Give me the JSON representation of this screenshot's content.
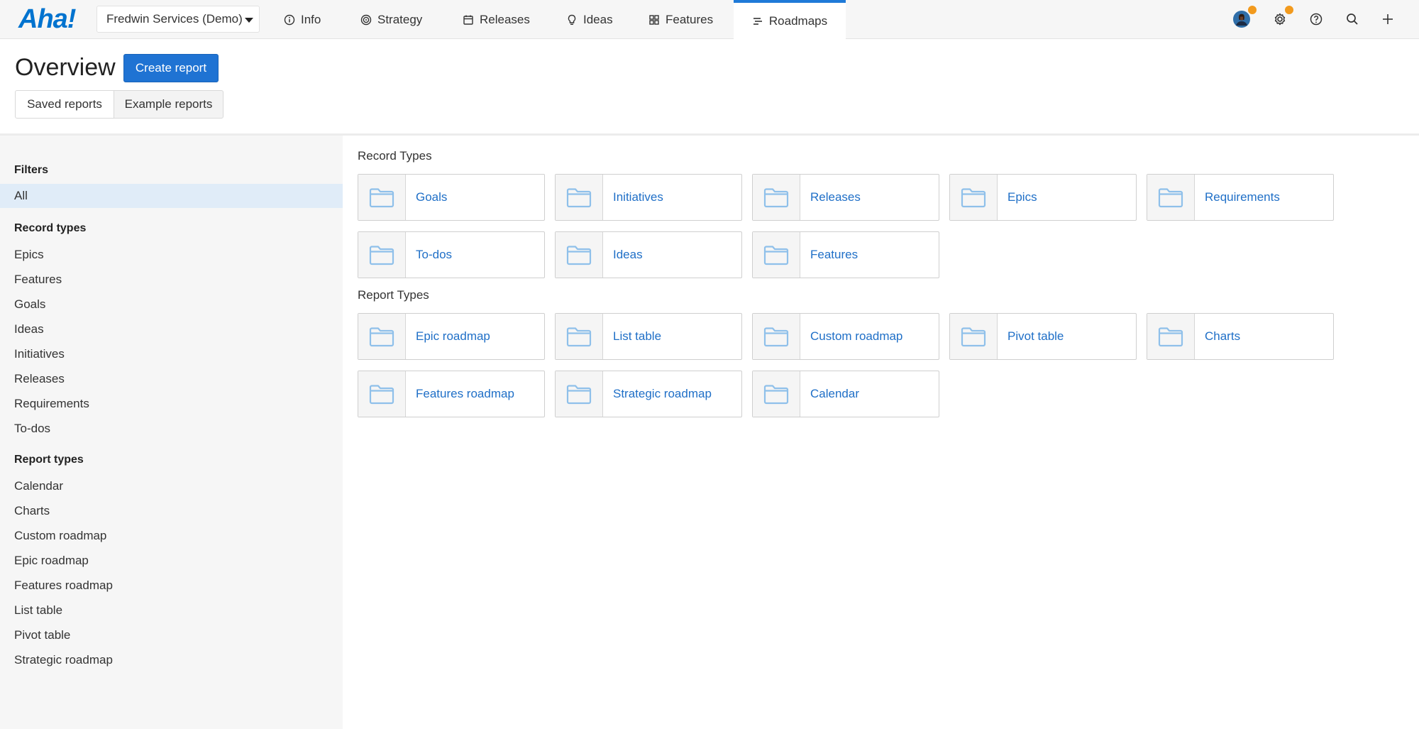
{
  "app": {
    "logo": "Aha!",
    "workspace": "Fredwin Services (Demo)"
  },
  "nav": {
    "tabs": [
      {
        "label": "Info",
        "icon": "info-icon"
      },
      {
        "label": "Strategy",
        "icon": "target-icon"
      },
      {
        "label": "Releases",
        "icon": "calendar-icon"
      },
      {
        "label": "Ideas",
        "icon": "lightbulb-icon"
      },
      {
        "label": "Features",
        "icon": "grid-icon"
      },
      {
        "label": "Roadmaps",
        "icon": "roadmap-icon",
        "active": true
      }
    ],
    "right_icons": [
      "avatar",
      "gear-icon",
      "help-icon",
      "search-icon",
      "plus-icon"
    ]
  },
  "header": {
    "title": "Overview",
    "create_button": "Create report",
    "toggle": {
      "saved": "Saved reports",
      "example": "Example reports"
    }
  },
  "sidebar": {
    "filters_heading": "Filters",
    "all_label": "All",
    "record_types_heading": "Record types",
    "record_types": [
      "Epics",
      "Features",
      "Goals",
      "Ideas",
      "Initiatives",
      "Releases",
      "Requirements",
      "To-dos"
    ],
    "report_types_heading": "Report types",
    "report_types": [
      "Calendar",
      "Charts",
      "Custom roadmap",
      "Epic roadmap",
      "Features roadmap",
      "List table",
      "Pivot table",
      "Strategic roadmap"
    ]
  },
  "main": {
    "record_types_label": "Record Types",
    "record_cards": [
      "Goals",
      "Initiatives",
      "Releases",
      "Epics",
      "Requirements",
      "To-dos",
      "Ideas",
      "Features"
    ],
    "report_types_label": "Report Types",
    "report_cards": [
      "Epic roadmap",
      "List table",
      "Custom roadmap",
      "Pivot table",
      "Charts",
      "Features roadmap",
      "Strategic roadmap",
      "Calendar"
    ]
  },
  "colors": {
    "accent": "#1f73d3",
    "link": "#1f6fc7",
    "folder": "#8fc0ea",
    "badge": "#f29a1d",
    "selected": "#e0ecf8"
  }
}
